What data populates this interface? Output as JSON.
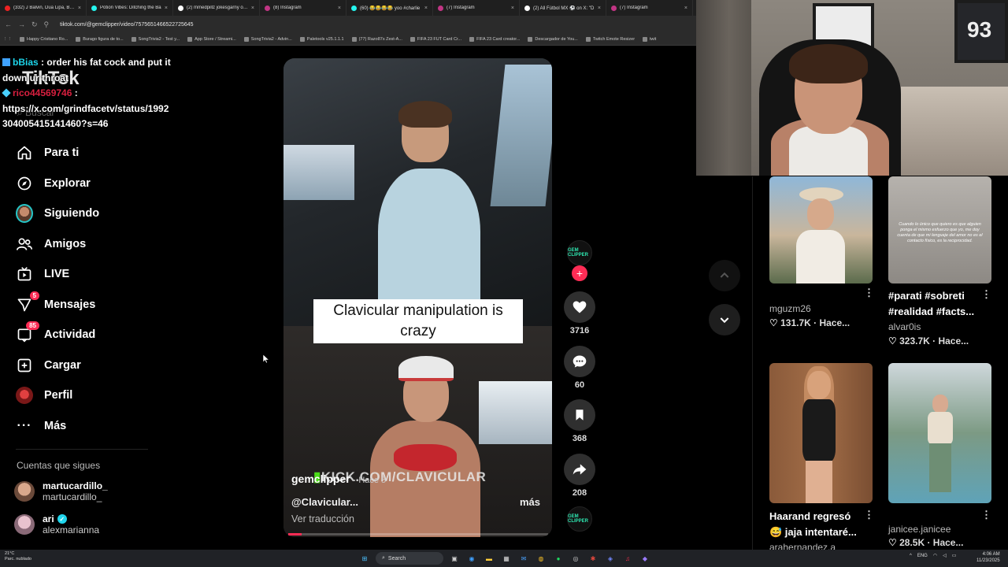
{
  "browser": {
    "tabs": [
      {
        "label": "(332) J Balvin, Dua Lipa, Bad B",
        "type": "yt"
      },
      {
        "label": "Potion Vibes: Ditching the Ba",
        "type": "tt"
      },
      {
        "label": "(2) mmedpillz jokesgarny on X",
        "type": "x"
      },
      {
        "label": "(8) Instagram",
        "type": "ig"
      },
      {
        "label": "(60) 😂😂😂😂 yoo #charlie",
        "type": "tt"
      },
      {
        "label": "(7) Instagram",
        "type": "ig"
      },
      {
        "label": "(2) All Fútbol MX ⚽ on X: \"D",
        "type": "x"
      },
      {
        "label": "(7) Instagram",
        "type": "ig"
      }
    ],
    "url": "tiktok.com/@gemclipper/video/7575651466522725645",
    "bookmarks": [
      "Happy Cristiano Ro...",
      "Burago figura de to...",
      "SongTrivia2 - Test y...",
      "App Store / Streami...",
      "SongTrivia2 - Advin...",
      "Paletools v25.1.1.1",
      "(77) Razo87s Zest-A...",
      "FIFA 23 FUT Card Cr...",
      "FIFA 23 Card creator...",
      "Descargador de You...",
      "Twitch Emote Resizer",
      "twit"
    ]
  },
  "sidebar": {
    "logo": "TikTok",
    "search_placeholder": "Buscar",
    "items": [
      {
        "label": "Para ti",
        "icon": "home-icon"
      },
      {
        "label": "Explorar",
        "icon": "compass-icon"
      },
      {
        "label": "Siguiendo",
        "icon": "avatar"
      },
      {
        "label": "Amigos",
        "icon": "friends-icon"
      },
      {
        "label": "LIVE",
        "icon": "live-tv-icon"
      },
      {
        "label": "Mensajes",
        "icon": "send-icon",
        "badge": "5"
      },
      {
        "label": "Actividad",
        "icon": "inbox-icon",
        "badge": "85"
      },
      {
        "label": "Cargar",
        "icon": "upload-plus-icon"
      },
      {
        "label": "Perfil",
        "icon": "profile-avatar"
      },
      {
        "label": "Más",
        "icon": "more-dots-icon"
      }
    ],
    "following_title": "Cuentas que sigues",
    "following": [
      {
        "name": "martucardillo_",
        "handle": "martucardillo_",
        "verified": false
      },
      {
        "name": "ari",
        "handle": "alexmarianna",
        "verified": true
      }
    ]
  },
  "chat": [
    {
      "user": "bBias",
      "text": ": order his fat cock and put it down ur throat"
    },
    {
      "user": "rico44569746",
      "text": ":"
    },
    {
      "user": "",
      "text": "https://x.com/grindfacetv/status/1992304005415141460?s=46"
    }
  ],
  "video": {
    "caption": "Clavicular manipulation is crazy",
    "watermark_prefix": "KICK.COM/",
    "watermark_name": "CLAVICULAR",
    "author": "gemclipper",
    "author_suffix": "· Hace 5",
    "description": "@Clavicular...",
    "more": "más",
    "translate": "Ver traducción",
    "progress": 0.05,
    "creator_badge": "GEM CLIPPER"
  },
  "actions": {
    "likes": "3716",
    "comments": "60",
    "saves": "368",
    "shares": "208"
  },
  "recommended": [
    {
      "caption": "",
      "user": "mguzm26",
      "stats": "♡ 131.7K · Hace...",
      "overlay": ""
    },
    {
      "caption": "#parati #sobreti #realidad #facts...",
      "user": "alvar0is",
      "stats": "♡ 323.7K · Hace...",
      "overlay": "Cuando lo único que quiero es que alguien ponga el mismo esfuerzo que yo, me doy cuenta de que mi lenguaje del amor no es el contacto físico, es la reciprocidad."
    },
    {
      "caption": "Haarand regresó 😅 jaja intentaré...",
      "user": "arahernandez.a",
      "stats": "",
      "overlay": ""
    },
    {
      "caption": "",
      "user": "janicee.janicee",
      "stats": "♡ 28.5K · Hace...",
      "overlay": ""
    }
  ],
  "webcam": {
    "jersey_number": "93"
  },
  "taskbar": {
    "weather_temp": "21°C",
    "weather_desc": "Parc. nublado",
    "search": "Search",
    "lang": "ENG",
    "time": "4:06 AM",
    "date": "11/23/2025"
  },
  "colors": {
    "accent": "#fe2c55",
    "teal": "#25c6c8",
    "kick_green": "#53fc18"
  }
}
